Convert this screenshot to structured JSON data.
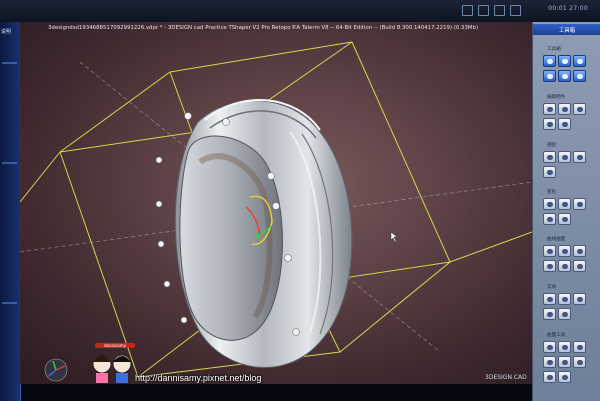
{
  "window": {
    "title": "3designdsd1934688517092991226.vdpr * - 3DESIGN cad Practice TShaper V2 Pro Retopo P.A Talerm V8 -- 64-Bit Edition --   (Build 8.300.140417.2219)  (0.33Mb)",
    "clock": "00:01 27:00"
  },
  "left_panel": {
    "label": "说明"
  },
  "right_panel": {
    "header": "工具箱",
    "sections": [
      {
        "name": "工具箱"
      },
      {
        "name": "编辑物件"
      },
      {
        "name": "捕捉"
      },
      {
        "name": "变形"
      },
      {
        "name": "曲线曲面"
      },
      {
        "name": "实体"
      },
      {
        "name": "曲面工具"
      }
    ]
  },
  "watermark": {
    "url": "http://dannisamy.pixnet.net/blog",
    "badge_text": "dannisamy"
  },
  "status": {
    "logo": "3DESIGN CAD"
  },
  "colors": {
    "viewport_bg": "#5e4246",
    "bounding_box": "#d6d64a",
    "ring_metal": "#c9cdd3",
    "panel_blue": "#1a3070"
  },
  "icons": [
    "pen-icon",
    "move-icon",
    "zoom-icon",
    "settings-icon",
    "ring-tool-icon"
  ]
}
